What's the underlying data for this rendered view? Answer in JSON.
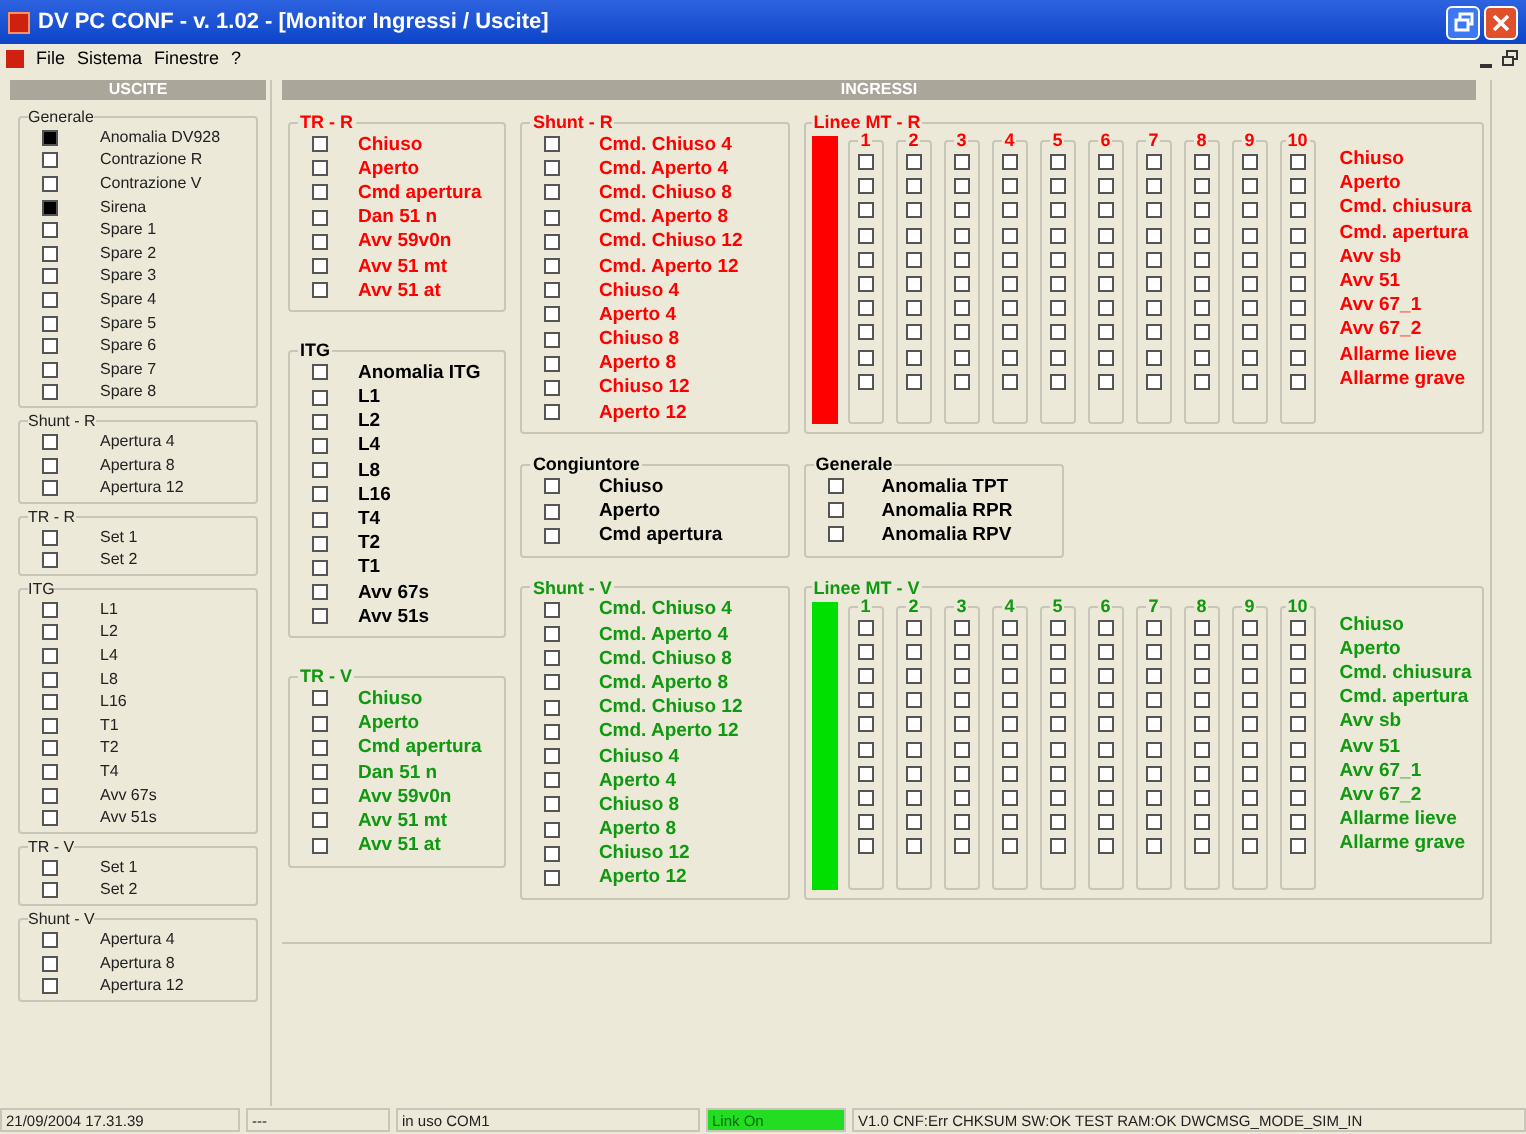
{
  "window": {
    "title": "DV PC CONF - v. 1.02 - [Monitor Ingressi / Uscite]"
  },
  "menu": [
    "File",
    "Sistema",
    "Finestre",
    "?"
  ],
  "uscite": {
    "title": "USCITE",
    "groups": [
      {
        "title": "Generale",
        "items": [
          {
            "label": "Anomalia DV928",
            "checked": true
          },
          {
            "label": "Contrazione R",
            "checked": false
          },
          {
            "label": "Contrazione V",
            "checked": false
          },
          {
            "label": "Sirena",
            "checked": true
          },
          {
            "label": "Spare 1",
            "checked": false
          },
          {
            "label": "Spare 2",
            "checked": false
          },
          {
            "label": "Spare 3",
            "checked": false
          },
          {
            "label": "Spare 4",
            "checked": false
          },
          {
            "label": "Spare 5",
            "checked": false
          },
          {
            "label": "Spare 6",
            "checked": false
          },
          {
            "label": "Spare 7",
            "checked": false
          },
          {
            "label": "Spare 8",
            "checked": false
          }
        ]
      },
      {
        "title": "Shunt - R",
        "items": [
          {
            "label": "Apertura 4",
            "checked": false
          },
          {
            "label": "Apertura 8",
            "checked": false
          },
          {
            "label": "Apertura 12",
            "checked": false
          }
        ]
      },
      {
        "title": "TR - R",
        "items": [
          {
            "label": "Set 1",
            "checked": false
          },
          {
            "label": "Set 2",
            "checked": false
          }
        ]
      },
      {
        "title": "ITG",
        "items": [
          {
            "label": "L1",
            "checked": false
          },
          {
            "label": "L2",
            "checked": false
          },
          {
            "label": "L4",
            "checked": false
          },
          {
            "label": "L8",
            "checked": false
          },
          {
            "label": "L16",
            "checked": false
          },
          {
            "label": "T1",
            "checked": false
          },
          {
            "label": "T2",
            "checked": false
          },
          {
            "label": "T4",
            "checked": false
          },
          {
            "label": "Avv 67s",
            "checked": false
          },
          {
            "label": "Avv 51s",
            "checked": false
          }
        ]
      },
      {
        "title": "TR - V",
        "items": [
          {
            "label": "Set 1",
            "checked": false
          },
          {
            "label": "Set 2",
            "checked": false
          }
        ]
      },
      {
        "title": "Shunt - V",
        "items": [
          {
            "label": "Apertura 4",
            "checked": false
          },
          {
            "label": "Apertura 8",
            "checked": false
          },
          {
            "label": "Apertura 12",
            "checked": false
          }
        ]
      }
    ]
  },
  "ingressi": {
    "title": "INGRESSI",
    "columns": [
      [
        {
          "kind": "list",
          "title": "TR - R",
          "color": "#ff0000",
          "items": [
            {
              "label": "Chiuso",
              "checked": false
            },
            {
              "label": "Aperto",
              "checked": false
            },
            {
              "label": "Cmd apertura",
              "checked": false
            },
            {
              "label": "Dan 51 n",
              "checked": false
            },
            {
              "label": "Avv 59v0n",
              "checked": false
            },
            {
              "label": "Avv 51 mt",
              "checked": false
            },
            {
              "label": "Avv 51 at",
              "checked": false
            }
          ]
        },
        {
          "kind": "list",
          "title": "ITG",
          "color": "#000000",
          "items": [
            {
              "label": "Anomalia ITG",
              "checked": false
            },
            {
              "label": "L1",
              "checked": false
            },
            {
              "label": "L2",
              "checked": false
            },
            {
              "label": "L4",
              "checked": false
            },
            {
              "label": "L8",
              "checked": false
            },
            {
              "label": "L16",
              "checked": false
            },
            {
              "label": "T4",
              "checked": false
            },
            {
              "label": "T2",
              "checked": false
            },
            {
              "label": "T1",
              "checked": false
            },
            {
              "label": "Avv 67s",
              "checked": false
            },
            {
              "label": "Avv 51s",
              "checked": false
            }
          ]
        },
        {
          "kind": "list",
          "title": "TR - V",
          "color": "#109810",
          "items": [
            {
              "label": "Chiuso",
              "checked": false
            },
            {
              "label": "Aperto",
              "checked": false
            },
            {
              "label": "Cmd apertura",
              "checked": false
            },
            {
              "label": "Dan 51 n",
              "checked": false
            },
            {
              "label": "Avv 59v0n",
              "checked": false
            },
            {
              "label": "Avv 51 mt",
              "checked": false
            },
            {
              "label": "Avv 51 at",
              "checked": false
            }
          ]
        }
      ],
      [
        {
          "kind": "list",
          "title": "Shunt - R",
          "color": "#ff0000",
          "items": [
            {
              "label": "Cmd. Chiuso 4",
              "checked": false
            },
            {
              "label": "Cmd. Aperto 4",
              "checked": false
            },
            {
              "label": "Cmd. Chiuso 8",
              "checked": false
            },
            {
              "label": "Cmd. Aperto 8",
              "checked": false
            },
            {
              "label": "Cmd. Chiuso 12",
              "checked": false
            },
            {
              "label": "Cmd. Aperto 12",
              "checked": false
            },
            {
              "label": "Chiuso 4",
              "checked": false
            },
            {
              "label": "Aperto 4",
              "checked": false
            },
            {
              "label": "Chiuso 8",
              "checked": false
            },
            {
              "label": "Aperto 8",
              "checked": false
            },
            {
              "label": "Chiuso 12",
              "checked": false
            },
            {
              "label": "Aperto 12",
              "checked": false
            }
          ]
        },
        {
          "kind": "list",
          "title": "Congiuntore",
          "color": "#000000",
          "items": [
            {
              "label": "Chiuso",
              "checked": false
            },
            {
              "label": "Aperto",
              "checked": false
            },
            {
              "label": "Cmd apertura",
              "checked": false
            }
          ]
        },
        {
          "kind": "list",
          "title": "Shunt - V",
          "color": "#109810",
          "items": [
            {
              "label": "Cmd. Chiuso 4",
              "checked": false
            },
            {
              "label": "Cmd. Aperto 4",
              "checked": false
            },
            {
              "label": "Cmd. Chiuso 8",
              "checked": false
            },
            {
              "label": "Cmd. Aperto 8",
              "checked": false
            },
            {
              "label": "Cmd. Chiuso 12",
              "checked": false
            },
            {
              "label": "Cmd. Aperto 12",
              "checked": false
            },
            {
              "label": "Chiuso 4",
              "checked": false
            },
            {
              "label": "Aperto 4",
              "checked": false
            },
            {
              "label": "Chiuso 8",
              "checked": false
            },
            {
              "label": "Aperto 8",
              "checked": false
            },
            {
              "label": "Chiuso 12",
              "checked": false
            },
            {
              "label": "Aperto 12",
              "checked": false
            }
          ]
        }
      ],
      [
        {
          "kind": "matrix",
          "title": "Linee MT - R",
          "color": "#ff0000",
          "indicator": {
            "color": "#ff0000"
          },
          "columns": [
            "1",
            "2",
            "3",
            "4",
            "5",
            "6",
            "7",
            "8",
            "9",
            "10"
          ],
          "rows": [
            {
              "label": "Chiuso",
              "checked": [
                false,
                false,
                false,
                false,
                false,
                false,
                false,
                false,
                false,
                false
              ]
            },
            {
              "label": "Aperto",
              "checked": [
                false,
                false,
                false,
                false,
                false,
                false,
                false,
                false,
                false,
                false
              ]
            },
            {
              "label": "Cmd. chiusura",
              "checked": [
                false,
                false,
                false,
                false,
                false,
                false,
                false,
                false,
                false,
                false
              ]
            },
            {
              "label": "Cmd. apertura",
              "checked": [
                false,
                false,
                false,
                false,
                false,
                false,
                false,
                false,
                false,
                false
              ]
            },
            {
              "label": "Avv sb",
              "checked": [
                false,
                false,
                false,
                false,
                false,
                false,
                false,
                false,
                false,
                false
              ]
            },
            {
              "label": "Avv 51",
              "checked": [
                false,
                false,
                false,
                false,
                false,
                false,
                false,
                false,
                false,
                false
              ]
            },
            {
              "label": "Avv 67_1",
              "checked": [
                false,
                false,
                false,
                false,
                false,
                false,
                false,
                false,
                false,
                false
              ]
            },
            {
              "label": "Avv 67_2",
              "checked": [
                false,
                false,
                false,
                false,
                false,
                false,
                false,
                false,
                false,
                false
              ]
            },
            {
              "label": "Allarme lieve",
              "checked": [
                false,
                false,
                false,
                false,
                false,
                false,
                false,
                false,
                false,
                false
              ]
            },
            {
              "label": "Allarme grave",
              "checked": [
                false,
                false,
                false,
                false,
                false,
                false,
                false,
                false,
                false,
                false
              ]
            }
          ]
        },
        {
          "kind": "list",
          "title": "Generale",
          "color": "#000000",
          "items": [
            {
              "label": "Anomalia TPT",
              "checked": false
            },
            {
              "label": "Anomalia RPR",
              "checked": false
            },
            {
              "label": "Anomalia RPV",
              "checked": false
            }
          ]
        },
        {
          "kind": "matrix",
          "title": "Linee MT - V",
          "color": "#109810",
          "indicator": {
            "color": "#00e000"
          },
          "columns": [
            "1",
            "2",
            "3",
            "4",
            "5",
            "6",
            "7",
            "8",
            "9",
            "10"
          ],
          "rows": [
            {
              "label": "Chiuso",
              "checked": [
                false,
                false,
                false,
                false,
                false,
                false,
                false,
                false,
                false,
                false
              ]
            },
            {
              "label": "Aperto",
              "checked": [
                false,
                false,
                false,
                false,
                false,
                false,
                false,
                false,
                false,
                false
              ]
            },
            {
              "label": "Cmd. chiusura",
              "checked": [
                false,
                false,
                false,
                false,
                false,
                false,
                false,
                false,
                false,
                false
              ]
            },
            {
              "label": "Cmd. apertura",
              "checked": [
                false,
                false,
                false,
                false,
                false,
                false,
                false,
                false,
                false,
                false
              ]
            },
            {
              "label": "Avv sb",
              "checked": [
                false,
                false,
                false,
                false,
                false,
                false,
                false,
                false,
                false,
                false
              ]
            },
            {
              "label": "Avv 51",
              "checked": [
                false,
                false,
                false,
                false,
                false,
                false,
                false,
                false,
                false,
                false
              ]
            },
            {
              "label": "Avv 67_1",
              "checked": [
                false,
                false,
                false,
                false,
                false,
                false,
                false,
                false,
                false,
                false
              ]
            },
            {
              "label": "Avv 67_2",
              "checked": [
                false,
                false,
                false,
                false,
                false,
                false,
                false,
                false,
                false,
                false
              ]
            },
            {
              "label": "Allarme lieve",
              "checked": [
                false,
                false,
                false,
                false,
                false,
                false,
                false,
                false,
                false,
                false
              ]
            },
            {
              "label": "Allarme grave",
              "checked": [
                false,
                false,
                false,
                false,
                false,
                false,
                false,
                false,
                false,
                false
              ]
            }
          ]
        }
      ]
    ]
  },
  "status_bar": [
    {
      "text": "21/09/2004 17.31.39",
      "highlighted": false
    },
    {
      "text": "---",
      "highlighted": false
    },
    {
      "text": "in uso COM1",
      "highlighted": false
    },
    {
      "text": "Link On",
      "highlighted": true
    },
    {
      "text": "V1.0 CNF:Err CHKSUM SW:OK TEST RAM:OK DWCMSG_MODE_SIM_IN",
      "highlighted": false
    }
  ]
}
